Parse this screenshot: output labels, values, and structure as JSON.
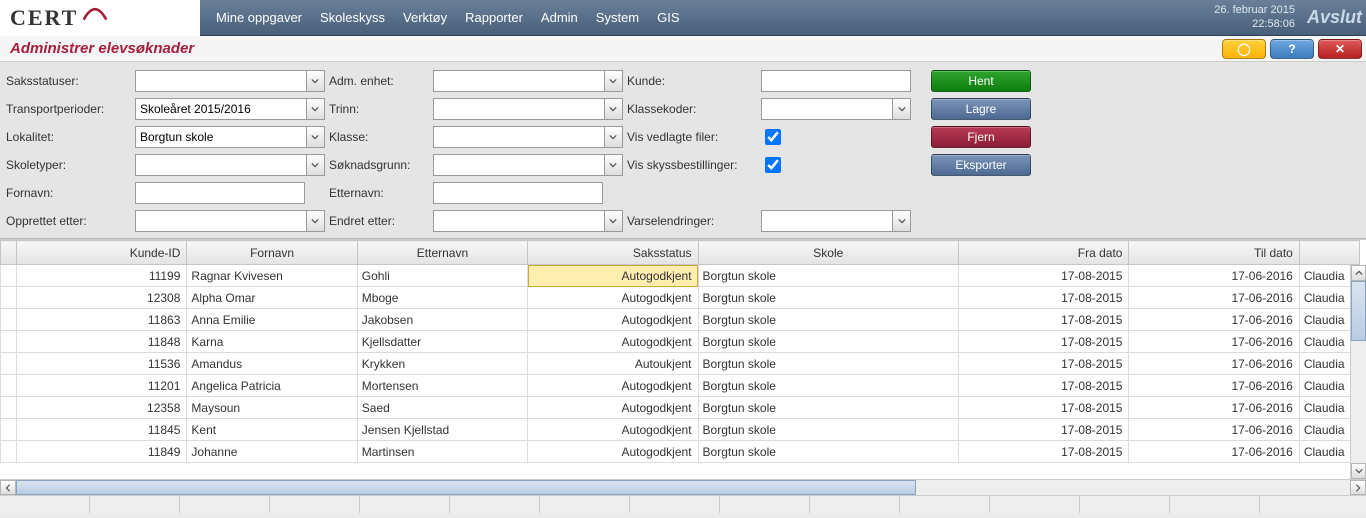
{
  "menubar": {
    "logo": "CERT",
    "items": [
      "Mine oppgaver",
      "Skoleskyss",
      "Verktøy",
      "Rapporter",
      "Admin",
      "System",
      "GIS"
    ],
    "date": "26. februar 2015",
    "time": "22:58:06",
    "logout": "Avslut"
  },
  "titlebar": {
    "title": "Administrer elevsøknader",
    "min": "◯",
    "help": "?",
    "close": "✕"
  },
  "filters": {
    "saksstatuser": {
      "label": "Saksstatuser:",
      "value": ""
    },
    "adm_enhet": {
      "label": "Adm. enhet:",
      "value": ""
    },
    "kunde": {
      "label": "Kunde:",
      "value": ""
    },
    "transportperioder": {
      "label": "Transportperioder:",
      "value": "Skoleåret 2015/2016"
    },
    "trinn": {
      "label": "Trinn:",
      "value": ""
    },
    "klassekoder": {
      "label": "Klassekoder:",
      "value": ""
    },
    "lokalitet": {
      "label": "Lokalitet:",
      "value": "Borgtun skole"
    },
    "klasse": {
      "label": "Klasse:",
      "value": ""
    },
    "vis_vedlagte": {
      "label": "Vis vedlagte filer:",
      "checked": true
    },
    "skoletyper": {
      "label": "Skoletyper:",
      "value": ""
    },
    "soknadsgrunn": {
      "label": "Søknadsgrunn:",
      "value": ""
    },
    "vis_skyss": {
      "label": "Vis skyssbestillinger:",
      "checked": true
    },
    "fornavn": {
      "label": "Fornavn:",
      "value": ""
    },
    "etternavn": {
      "label": "Etternavn:",
      "value": ""
    },
    "opprettet": {
      "label": "Opprettet etter:",
      "value": ""
    },
    "endret": {
      "label": "Endret etter:",
      "value": ""
    },
    "varsel": {
      "label": "Varselendringer:",
      "value": ""
    }
  },
  "buttons": {
    "hent": "Hent",
    "lagre": "Lagre",
    "fjern": "Fjern",
    "eksporter": "Eksporter"
  },
  "table": {
    "columns": [
      "Kunde-ID",
      "Fornavn",
      "Etternavn",
      "Saksstatus",
      "Skole",
      "Fra dato",
      "Til dato",
      ""
    ],
    "rows": [
      {
        "id": "11199",
        "fornavn": "Ragnar Kvivesen",
        "etternavn": "Gohli",
        "status": "Autogodkjent",
        "skole": "Borgtun skole",
        "fra": "17-08-2015",
        "til": "17-06-2016",
        "last": "Claudia",
        "selected_col": "status"
      },
      {
        "id": "12308",
        "fornavn": "Alpha Omar",
        "etternavn": "Mboge",
        "status": "Autogodkjent",
        "skole": "Borgtun skole",
        "fra": "17-08-2015",
        "til": "17-06-2016",
        "last": "Claudia"
      },
      {
        "id": "11863",
        "fornavn": "Anna Emilie",
        "etternavn": "Jakobsen",
        "status": "Autogodkjent",
        "skole": "Borgtun skole",
        "fra": "17-08-2015",
        "til": "17-06-2016",
        "last": "Claudia"
      },
      {
        "id": "11848",
        "fornavn": "Karna",
        "etternavn": "Kjellsdatter",
        "status": "Autogodkjent",
        "skole": "Borgtun skole",
        "fra": "17-08-2015",
        "til": "17-06-2016",
        "last": "Claudia"
      },
      {
        "id": "11536",
        "fornavn": "Amandus",
        "etternavn": "Krykken",
        "status": "Autoukjent",
        "skole": "Borgtun skole",
        "fra": "17-08-2015",
        "til": "17-06-2016",
        "last": "Claudia"
      },
      {
        "id": "11201",
        "fornavn": "Angelica Patricia",
        "etternavn": "Mortensen",
        "status": "Autogodkjent",
        "skole": "Borgtun skole",
        "fra": "17-08-2015",
        "til": "17-06-2016",
        "last": "Claudia"
      },
      {
        "id": "12358",
        "fornavn": "Maysoun",
        "etternavn": "Saed",
        "status": "Autogodkjent",
        "skole": "Borgtun skole",
        "fra": "17-08-2015",
        "til": "17-06-2016",
        "last": "Claudia"
      },
      {
        "id": "11845",
        "fornavn": "Kent",
        "etternavn": "Jensen Kjellstad",
        "status": "Autogodkjent",
        "skole": "Borgtun skole",
        "fra": "17-08-2015",
        "til": "17-06-2016",
        "last": "Claudia"
      },
      {
        "id": "11849",
        "fornavn": "Johanne",
        "etternavn": "Martinsen",
        "status": "Autogodkjent",
        "skole": "Borgtun skole",
        "fra": "17-08-2015",
        "til": "17-06-2016",
        "last": "Claudia"
      }
    ]
  }
}
